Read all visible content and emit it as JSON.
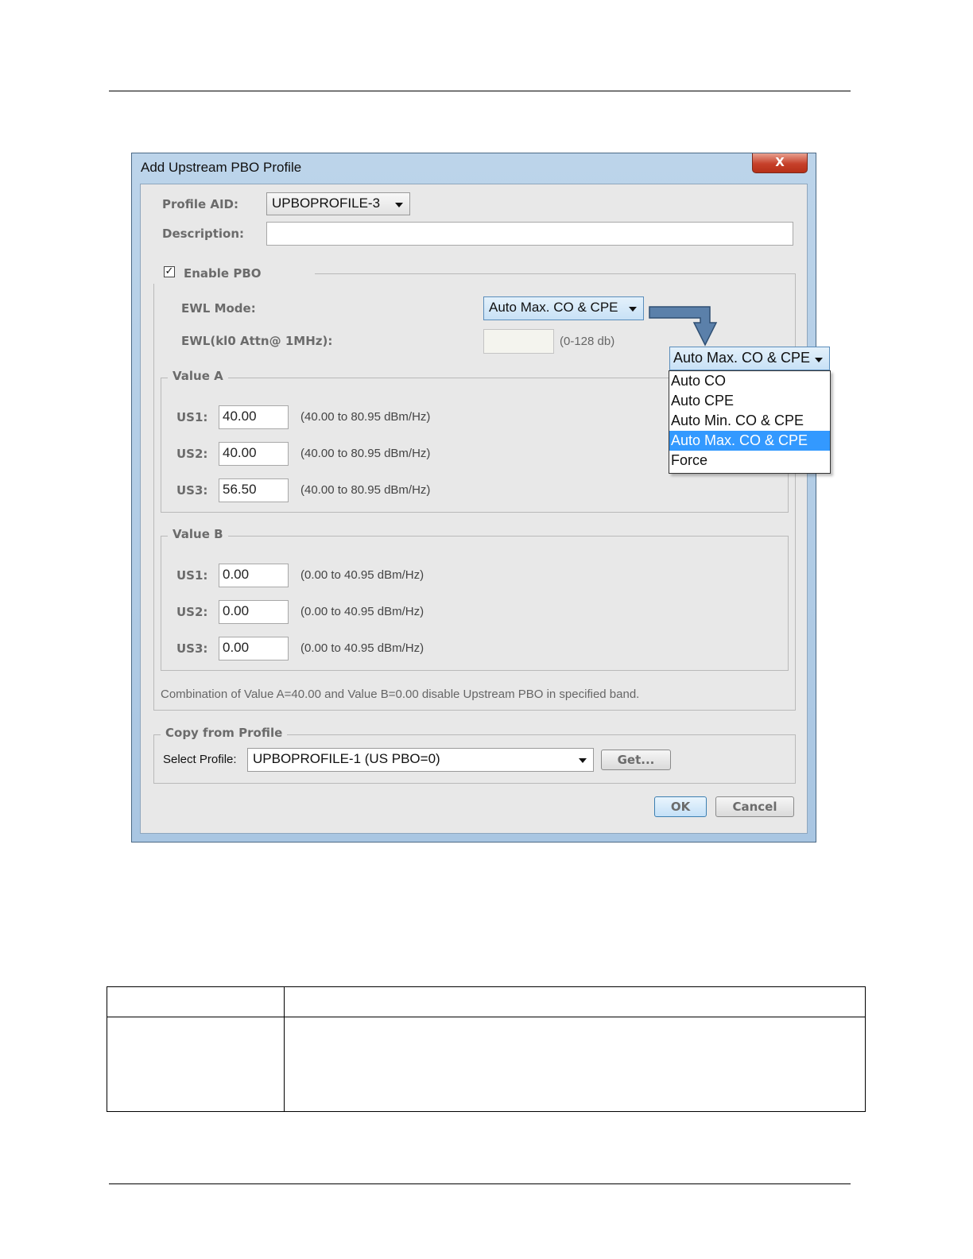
{
  "dialog": {
    "title": "Add Upstream PBO Profile",
    "close_label": "X",
    "profile_aid_label": "Profile AID:",
    "profile_aid_value": "UPBOPROFILE-3",
    "description_label": "Description:",
    "description_value": "",
    "enable_pbo_label": "Enable PBO",
    "enable_pbo_checked": true,
    "ewl_mode_label": "EWL Mode:",
    "ewl_mode_value": "Auto Max. CO & CPE",
    "ewl_attn_label": "EWL(kl0 Attn@ 1MHz):",
    "ewl_attn_value": "",
    "ewl_attn_range": "(0-128 db)",
    "value_a": {
      "title": "Value A",
      "rows": [
        {
          "label": "US1:",
          "value": "40.00",
          "range": "(40.00 to 80.95 dBm/Hz)"
        },
        {
          "label": "US2:",
          "value": "40.00",
          "range": "(40.00 to 80.95 dBm/Hz)"
        },
        {
          "label": "US3:",
          "value": "56.50",
          "range": "(40.00 to 80.95 dBm/Hz)"
        }
      ]
    },
    "value_b": {
      "title": "Value B",
      "rows": [
        {
          "label": "US1:",
          "value": "0.00",
          "range": "(0.00 to 40.95 dBm/Hz)"
        },
        {
          "label": "US2:",
          "value": "0.00",
          "range": "(0.00 to 40.95 dBm/Hz)"
        },
        {
          "label": "US3:",
          "value": "0.00",
          "range": "(0.00 to 40.95 dBm/Hz)"
        }
      ]
    },
    "note": "Combination of Value A=40.00 and Value B=0.00 disable Upstream PBO in specified band.",
    "copy_from_profile": {
      "title": "Copy from Profile",
      "select_label": "Select Profile:",
      "select_value": "UPBOPROFILE-1 (US PBO=0)",
      "get_label": "Get..."
    },
    "ok_label": "OK",
    "cancel_label": "Cancel"
  },
  "callout": {
    "selected_value": "Auto Max. CO & CPE",
    "options": [
      "Auto CO",
      "Auto CPE",
      "Auto Min. CO & CPE",
      "Auto Max. CO & CPE",
      "Force"
    ],
    "selected_index": 3,
    "arrow_color": "#5b80aa"
  },
  "colors": {
    "title_gradient": "#bcd4ea",
    "selection_blue": "#3399ff",
    "close_red": "#c6402a"
  }
}
